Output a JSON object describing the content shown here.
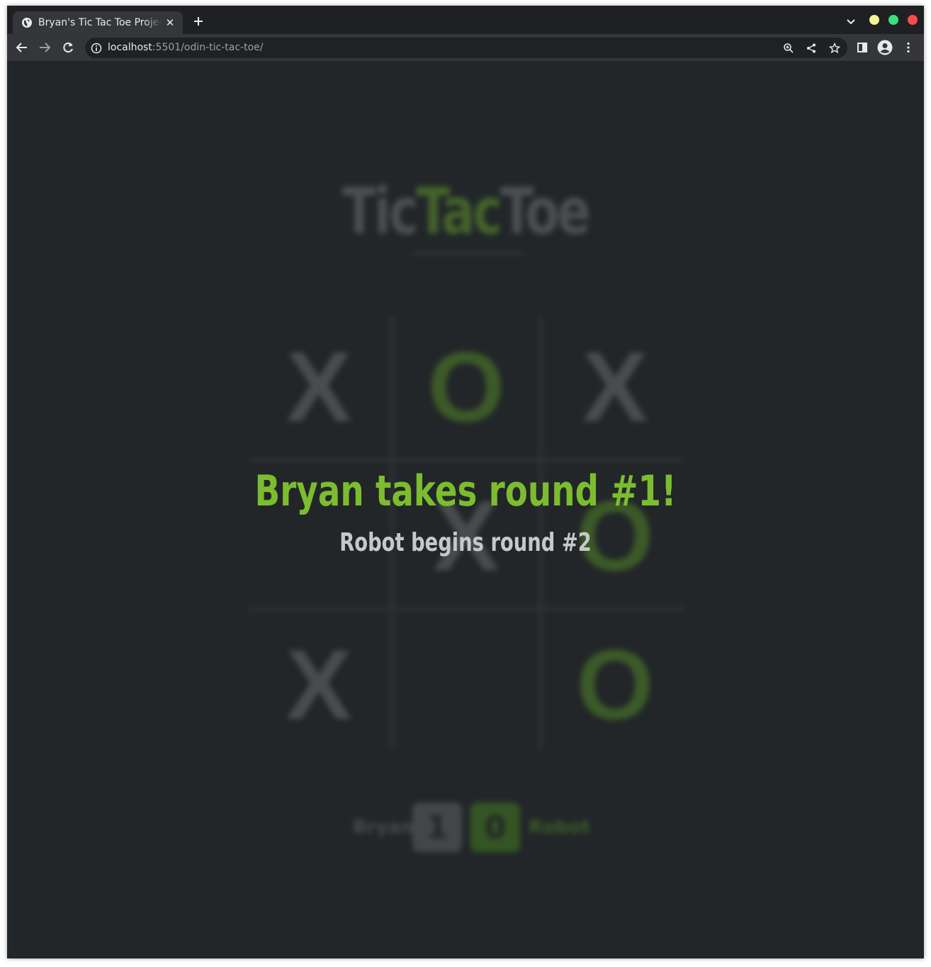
{
  "browser": {
    "tab_title": "Bryan's Tic Tac Toe Project",
    "tab_close": "✕",
    "url_host": "localhost",
    "url_rest": ":5501/odin-tic-tac-toe/"
  },
  "page": {
    "logo": {
      "tic": "Tic",
      "tac": "Tac",
      "toe": "Toe"
    },
    "board": {
      "cells": [
        "X",
        "O",
        "X",
        "",
        "X",
        "O",
        "X",
        "",
        "O"
      ]
    },
    "score": {
      "player1_name": "Bryan",
      "player1_score": "1",
      "player2_name": "Robot",
      "player2_score": "0"
    },
    "announcement": "Bryan takes round #1!",
    "sub_announcement": "Robot begins round #2"
  },
  "colors": {
    "accent_green": "#7cbd2f",
    "background": "#222629",
    "x_mark": "#7a7a7a"
  }
}
